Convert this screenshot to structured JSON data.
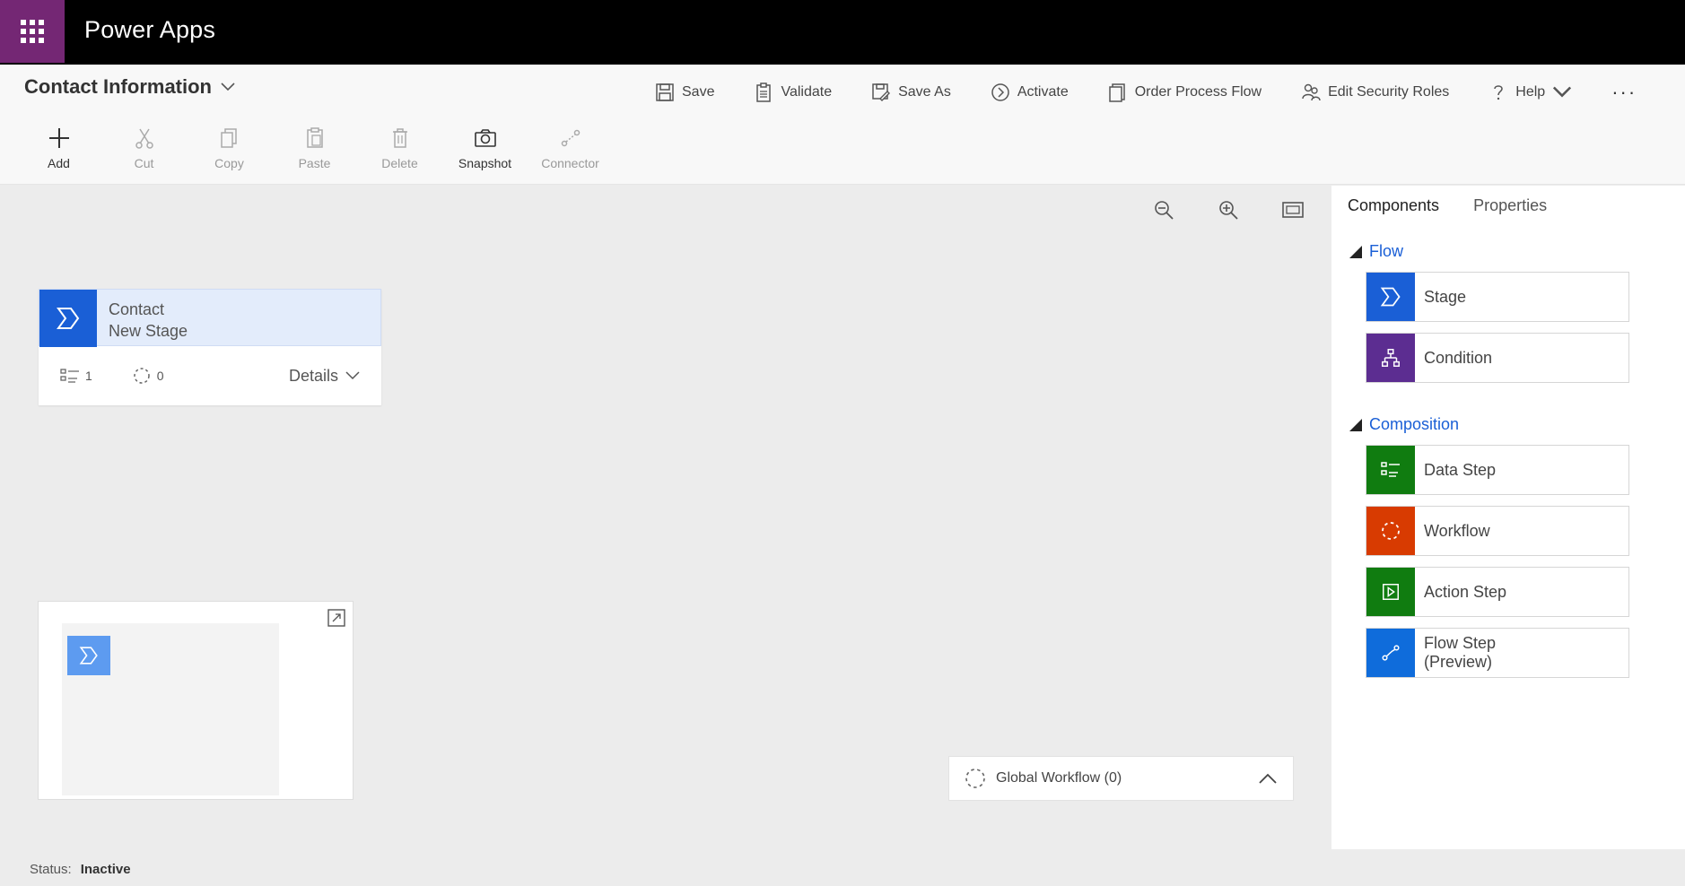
{
  "app": {
    "title": "Power Apps",
    "waffle_icon": "waffle-icon",
    "brand_color": "#742774"
  },
  "process": {
    "title": "Contact Information"
  },
  "actions": [
    {
      "label": "Save",
      "icon": "save-icon"
    },
    {
      "label": "Validate",
      "icon": "clipboard-icon"
    },
    {
      "label": "Save As",
      "icon": "save-as-icon"
    },
    {
      "label": "Activate",
      "icon": "activate-icon"
    },
    {
      "label": "Order Process Flow",
      "icon": "document-icon"
    },
    {
      "label": "Edit Security Roles",
      "icon": "people-icon"
    },
    {
      "label": "Help",
      "icon": "question-icon"
    },
    {
      "label": "···",
      "icon": "more-icon"
    }
  ],
  "tools": [
    {
      "label": "Add",
      "icon": "plus-icon",
      "enabled": true
    },
    {
      "label": "Cut",
      "icon": "scissors-icon",
      "enabled": false
    },
    {
      "label": "Copy",
      "icon": "copy-icon",
      "enabled": false
    },
    {
      "label": "Paste",
      "icon": "paste-icon",
      "enabled": false
    },
    {
      "label": "Delete",
      "icon": "trash-icon",
      "enabled": false
    },
    {
      "label": "Snapshot",
      "icon": "camera-icon",
      "enabled": true
    },
    {
      "label": "Connector",
      "icon": "connector-icon",
      "enabled": false
    }
  ],
  "canvas": {
    "stage": {
      "entity": "Contact",
      "name": "New Stage",
      "data_steps": "1",
      "workflows": "0",
      "details_label": "Details"
    },
    "global_workflow": {
      "label": "Global Workflow (0)"
    }
  },
  "status": {
    "label": "Status:",
    "value": "Inactive"
  },
  "panel": {
    "tabs": [
      "Components",
      "Properties"
    ],
    "flow_section": "Flow",
    "flow_items": [
      {
        "label": "Stage",
        "color": "#1a5fd6",
        "icon": "stage-icon"
      },
      {
        "label": "Condition",
        "color": "#5c2d91",
        "icon": "condition-icon"
      }
    ],
    "composition_section": "Composition",
    "composition_items": [
      {
        "label": "Data Step",
        "color": "#107c10",
        "icon": "data-step-icon"
      },
      {
        "label": "Workflow",
        "color": "#d83b01",
        "icon": "workflow-icon"
      },
      {
        "label": "Action Step",
        "color": "#107c10",
        "icon": "action-step-icon"
      },
      {
        "label": "Flow Step",
        "sub": "(Preview)",
        "color": "#0f6cdb",
        "icon": "flow-step-icon"
      }
    ]
  }
}
